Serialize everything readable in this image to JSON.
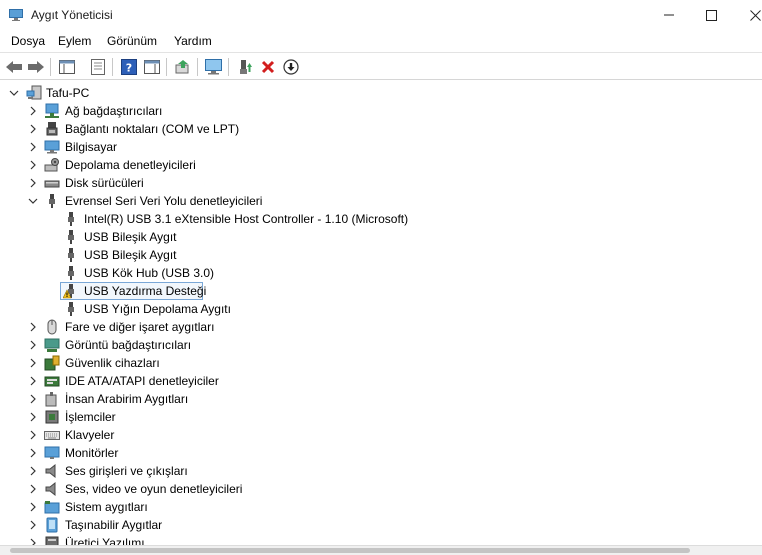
{
  "window": {
    "title": "Aygıt Yöneticisi"
  },
  "menu": [
    "Dosya",
    "Eylem",
    "Görünüm",
    "Yardım"
  ],
  "toolbar": [
    {
      "name": "back-button",
      "icon": "back-arrow-icon"
    },
    {
      "name": "forward-button",
      "icon": "forward-arrow-icon"
    },
    {
      "name": "show-hide-tree-button",
      "icon": "console-tree-icon"
    },
    {
      "name": "properties-button",
      "icon": "properties-icon"
    },
    {
      "name": "help-button",
      "icon": "help-icon"
    },
    {
      "name": "show-hide-action-pane-button",
      "icon": "action-pane-icon"
    },
    {
      "name": "update-driver-button",
      "icon": "update-driver-icon"
    },
    {
      "name": "scan-hardware-button",
      "icon": "monitor-scan-icon"
    },
    {
      "name": "enable-device-button",
      "icon": "enable-device-icon"
    },
    {
      "name": "uninstall-device-button",
      "icon": "red-x-icon"
    },
    {
      "name": "disable-device-button",
      "icon": "down-arrow-circle-icon"
    }
  ],
  "tree": {
    "root": "Tafu-PC",
    "categories": [
      {
        "label": "Ağ bağdaştırıcıları",
        "icon": "network-icon",
        "expanded": false
      },
      {
        "label": "Bağlantı noktaları (COM ve LPT)",
        "icon": "port-icon",
        "expanded": false
      },
      {
        "label": "Bilgisayar",
        "icon": "computer-icon",
        "expanded": false
      },
      {
        "label": "Depolama denetleyicileri",
        "icon": "storage-controller-icon",
        "expanded": false
      },
      {
        "label": "Disk sürücüleri",
        "icon": "disk-drive-icon",
        "expanded": false
      },
      {
        "label": "Evrensel Seri Veri Yolu denetleyicileri",
        "icon": "usb-icon",
        "expanded": true,
        "children": [
          {
            "label": "Intel(R) USB 3.1 eXtensible Host Controller - 1.10 (Microsoft)",
            "icon": "usb-icon"
          },
          {
            "label": "USB Bileşik Aygıt",
            "icon": "usb-icon"
          },
          {
            "label": "USB Bileşik Aygıt",
            "icon": "usb-icon"
          },
          {
            "label": "USB Kök Hub (USB 3.0)",
            "icon": "usb-icon"
          },
          {
            "label": "USB Yazdırma Desteği",
            "icon": "usb-warning-icon",
            "selected": true
          },
          {
            "label": "USB Yığın Depolama Aygıtı",
            "icon": "usb-icon"
          }
        ]
      },
      {
        "label": "Fare ve diğer işaret aygıtları",
        "icon": "mouse-icon",
        "expanded": false
      },
      {
        "label": "Görüntü bağdaştırıcıları",
        "icon": "display-adapter-icon",
        "expanded": false
      },
      {
        "label": "Güvenlik cihazları",
        "icon": "security-device-icon",
        "expanded": false
      },
      {
        "label": "IDE ATA/ATAPI denetleyiciler",
        "icon": "ide-controller-icon",
        "expanded": false
      },
      {
        "label": "İnsan Arabirim Aygıtları",
        "icon": "hid-icon",
        "expanded": false
      },
      {
        "label": "İşlemciler",
        "icon": "processor-icon",
        "expanded": false
      },
      {
        "label": "Klavyeler",
        "icon": "keyboard-icon",
        "expanded": false
      },
      {
        "label": "Monitörler",
        "icon": "monitor-icon",
        "expanded": false
      },
      {
        "label": "Ses girişleri ve çıkışları",
        "icon": "speaker-icon",
        "expanded": false
      },
      {
        "label": "Ses, video ve oyun denetleyicileri",
        "icon": "speaker-icon",
        "expanded": false
      },
      {
        "label": "Sistem aygıtları",
        "icon": "system-device-icon",
        "expanded": false
      },
      {
        "label": "Taşınabilir Aygıtlar",
        "icon": "portable-device-icon",
        "expanded": false
      },
      {
        "label": "Üretici Yazılımı",
        "icon": "firmware-icon",
        "expanded": false
      }
    ]
  }
}
